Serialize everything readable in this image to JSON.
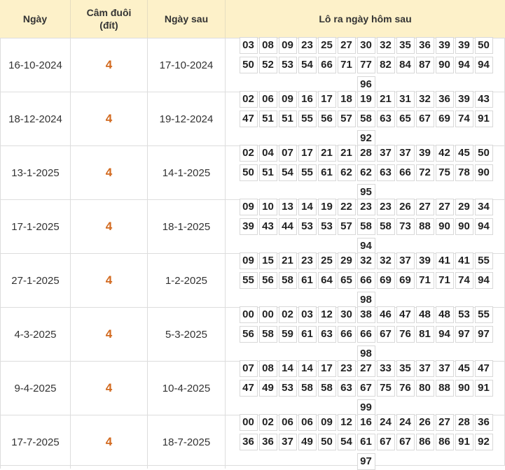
{
  "headers": {
    "ngay": "Ngày",
    "cam_duoi_line1": "Câm đuôi",
    "cam_duoi_line2": "(đít)",
    "ngay_sau": "Ngày sau",
    "lo_ra": "Lô ra ngày hôm sau"
  },
  "rows": [
    {
      "ngay": "16-10-2024",
      "cam": "4",
      "ngay_sau": "17-10-2024",
      "nums": [
        "03",
        "08",
        "09",
        "23",
        "25",
        "27",
        "30",
        "32",
        "35",
        "36",
        "39",
        "39",
        "50",
        "50",
        "52",
        "53",
        "54",
        "66",
        "71",
        "77",
        "82",
        "84",
        "87",
        "90",
        "94",
        "94",
        "96"
      ]
    },
    {
      "ngay": "18-12-2024",
      "cam": "4",
      "ngay_sau": "19-12-2024",
      "nums": [
        "02",
        "06",
        "09",
        "16",
        "17",
        "18",
        "19",
        "21",
        "31",
        "32",
        "36",
        "39",
        "43",
        "47",
        "51",
        "51",
        "55",
        "56",
        "57",
        "58",
        "63",
        "65",
        "67",
        "69",
        "74",
        "91",
        "92"
      ]
    },
    {
      "ngay": "13-1-2025",
      "cam": "4",
      "ngay_sau": "14-1-2025",
      "nums": [
        "02",
        "04",
        "07",
        "17",
        "21",
        "21",
        "28",
        "37",
        "37",
        "39",
        "42",
        "45",
        "50",
        "50",
        "51",
        "54",
        "55",
        "61",
        "62",
        "62",
        "63",
        "66",
        "72",
        "75",
        "78",
        "90",
        "95"
      ]
    },
    {
      "ngay": "17-1-2025",
      "cam": "4",
      "ngay_sau": "18-1-2025",
      "nums": [
        "09",
        "10",
        "13",
        "14",
        "19",
        "22",
        "23",
        "23",
        "26",
        "27",
        "27",
        "29",
        "34",
        "39",
        "43",
        "44",
        "53",
        "53",
        "57",
        "58",
        "58",
        "73",
        "88",
        "90",
        "90",
        "94",
        "94"
      ]
    },
    {
      "ngay": "27-1-2025",
      "cam": "4",
      "ngay_sau": "1-2-2025",
      "nums": [
        "09",
        "15",
        "21",
        "23",
        "25",
        "29",
        "32",
        "32",
        "37",
        "39",
        "41",
        "41",
        "55",
        "55",
        "56",
        "58",
        "61",
        "64",
        "65",
        "66",
        "69",
        "69",
        "71",
        "71",
        "74",
        "94",
        "98"
      ]
    },
    {
      "ngay": "4-3-2025",
      "cam": "4",
      "ngay_sau": "5-3-2025",
      "nums": [
        "00",
        "00",
        "02",
        "03",
        "12",
        "30",
        "38",
        "46",
        "47",
        "48",
        "48",
        "53",
        "55",
        "56",
        "58",
        "59",
        "61",
        "63",
        "66",
        "66",
        "67",
        "76",
        "81",
        "94",
        "97",
        "97",
        "98"
      ]
    },
    {
      "ngay": "9-4-2025",
      "cam": "4",
      "ngay_sau": "10-4-2025",
      "nums": [
        "07",
        "08",
        "14",
        "14",
        "17",
        "23",
        "27",
        "33",
        "35",
        "37",
        "37",
        "45",
        "47",
        "47",
        "49",
        "53",
        "58",
        "58",
        "63",
        "67",
        "75",
        "76",
        "80",
        "88",
        "90",
        "91",
        "99"
      ]
    },
    {
      "ngay": "17-7-2025",
      "cam": "4",
      "ngay_sau": "18-7-2025",
      "nums": [
        "00",
        "02",
        "06",
        "06",
        "09",
        "12",
        "16",
        "24",
        "24",
        "26",
        "27",
        "28",
        "36",
        "36",
        "36",
        "37",
        "49",
        "50",
        "54",
        "61",
        "67",
        "67",
        "86",
        "86",
        "91",
        "92",
        "97"
      ]
    }
  ]
}
